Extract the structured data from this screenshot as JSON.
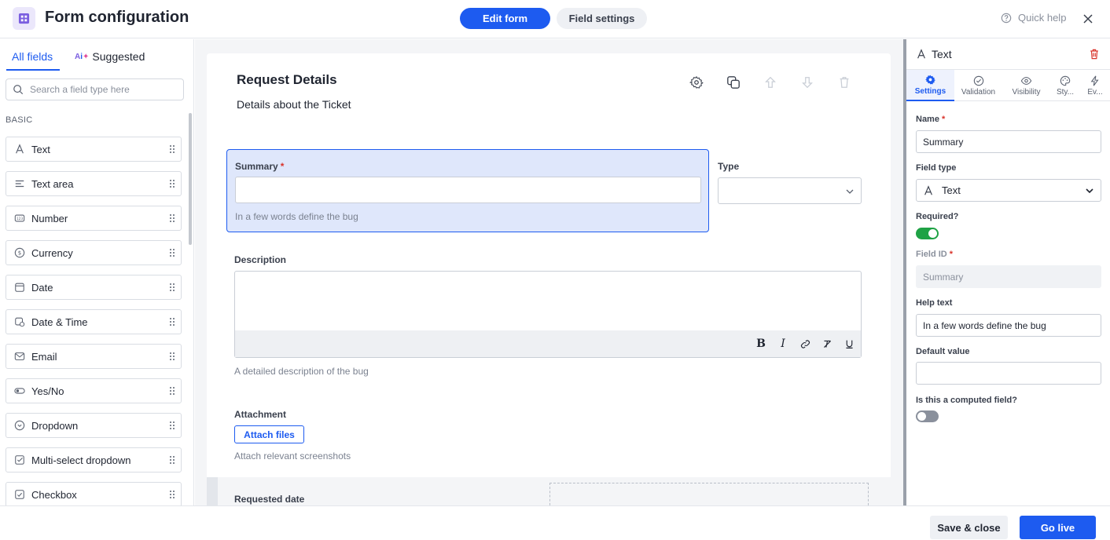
{
  "header": {
    "title": "Form configuration",
    "tabs": [
      {
        "label": "Edit form",
        "active": true
      },
      {
        "label": "Field settings",
        "active": false
      }
    ],
    "quick_help": "Quick help"
  },
  "left_panel": {
    "tabs": [
      {
        "label": "All fields",
        "active": true
      },
      {
        "label": "Suggested",
        "active": false
      }
    ],
    "search_placeholder": "Search a field type here",
    "section_label": "BASIC",
    "fields": [
      {
        "label": "Text",
        "icon": "text-icon"
      },
      {
        "label": "Text area",
        "icon": "text-area-icon"
      },
      {
        "label": "Number",
        "icon": "number-icon"
      },
      {
        "label": "Currency",
        "icon": "currency-icon"
      },
      {
        "label": "Date",
        "icon": "calendar-icon"
      },
      {
        "label": "Date & Time",
        "icon": "calendar-clock-icon"
      },
      {
        "label": "Email",
        "icon": "email-icon"
      },
      {
        "label": "Yes/No",
        "icon": "toggle-icon"
      },
      {
        "label": "Dropdown",
        "icon": "dropdown-icon"
      },
      {
        "label": "Multi-select dropdown",
        "icon": "multi-select-icon"
      },
      {
        "label": "Checkbox",
        "icon": "checkbox-icon"
      }
    ]
  },
  "canvas": {
    "section_title": "Request Details",
    "section_subtitle": "Details about the Ticket",
    "summary": {
      "label": "Summary",
      "required_mark": "*",
      "value": "",
      "help": "In a few words define the bug"
    },
    "type": {
      "label": "Type",
      "value": ""
    },
    "description": {
      "label": "Description",
      "help": "A detailed description of the bug"
    },
    "attachment": {
      "label": "Attachment",
      "button": "Attach files",
      "help": "Attach relevant screenshots"
    },
    "requested_date": {
      "label": "Requested date"
    }
  },
  "right_panel": {
    "field_type_title": "Text",
    "tabs": [
      {
        "label": "Settings",
        "icon": "gear-icon",
        "active": true
      },
      {
        "label": "Validation",
        "icon": "check-circle-icon",
        "active": false
      },
      {
        "label": "Visibility",
        "icon": "eye-icon",
        "active": false
      },
      {
        "label": "Sty...",
        "icon": "palette-icon",
        "active": false
      },
      {
        "label": "Ev...",
        "icon": "lightning-icon",
        "active": false
      }
    ],
    "name_label": "Name",
    "name_value": "Summary",
    "field_type_label": "Field type",
    "field_type_value": "Text",
    "required_label": "Required?",
    "required": true,
    "field_id_label": "Field ID",
    "field_id_value": "Summary",
    "help_text_label": "Help text",
    "help_text_value": "In a few words define the bug",
    "default_value_label": "Default value",
    "default_value": "",
    "computed_label": "Is this a computed field?",
    "computed": false
  },
  "footer": {
    "save_label": "Save & close",
    "go_live_label": "Go live"
  },
  "colors": {
    "accent": "#1d5bf0",
    "toggle_on": "#1fa245",
    "required": "#d9342b",
    "danger": "#d9342b"
  }
}
